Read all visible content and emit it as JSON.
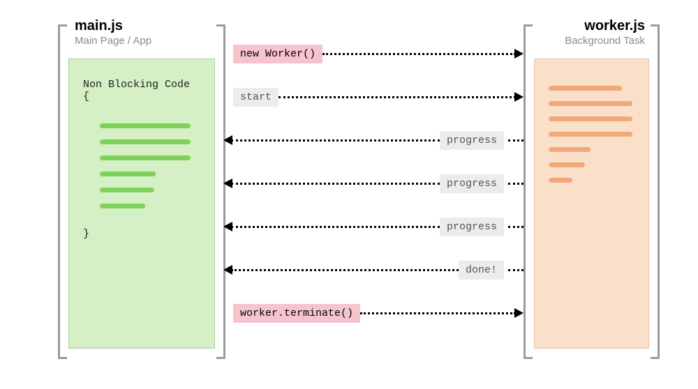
{
  "left": {
    "title": "main.js",
    "subtitle": "Main Page / App",
    "code_open": "Non Blocking Code {",
    "code_close": "}"
  },
  "right": {
    "title": "worker.js",
    "subtitle": "Background Task"
  },
  "messages": [
    {
      "label": "new Worker()",
      "style": "pink",
      "direction": "right"
    },
    {
      "label": "start",
      "style": "gray",
      "direction": "right"
    },
    {
      "label": "progress",
      "style": "gray",
      "direction": "left"
    },
    {
      "label": "progress",
      "style": "gray",
      "direction": "left"
    },
    {
      "label": "progress",
      "style": "gray",
      "direction": "left"
    },
    {
      "label": "done!",
      "style": "gray",
      "direction": "left"
    },
    {
      "label": "worker.terminate()",
      "style": "pink",
      "direction": "right"
    }
  ]
}
